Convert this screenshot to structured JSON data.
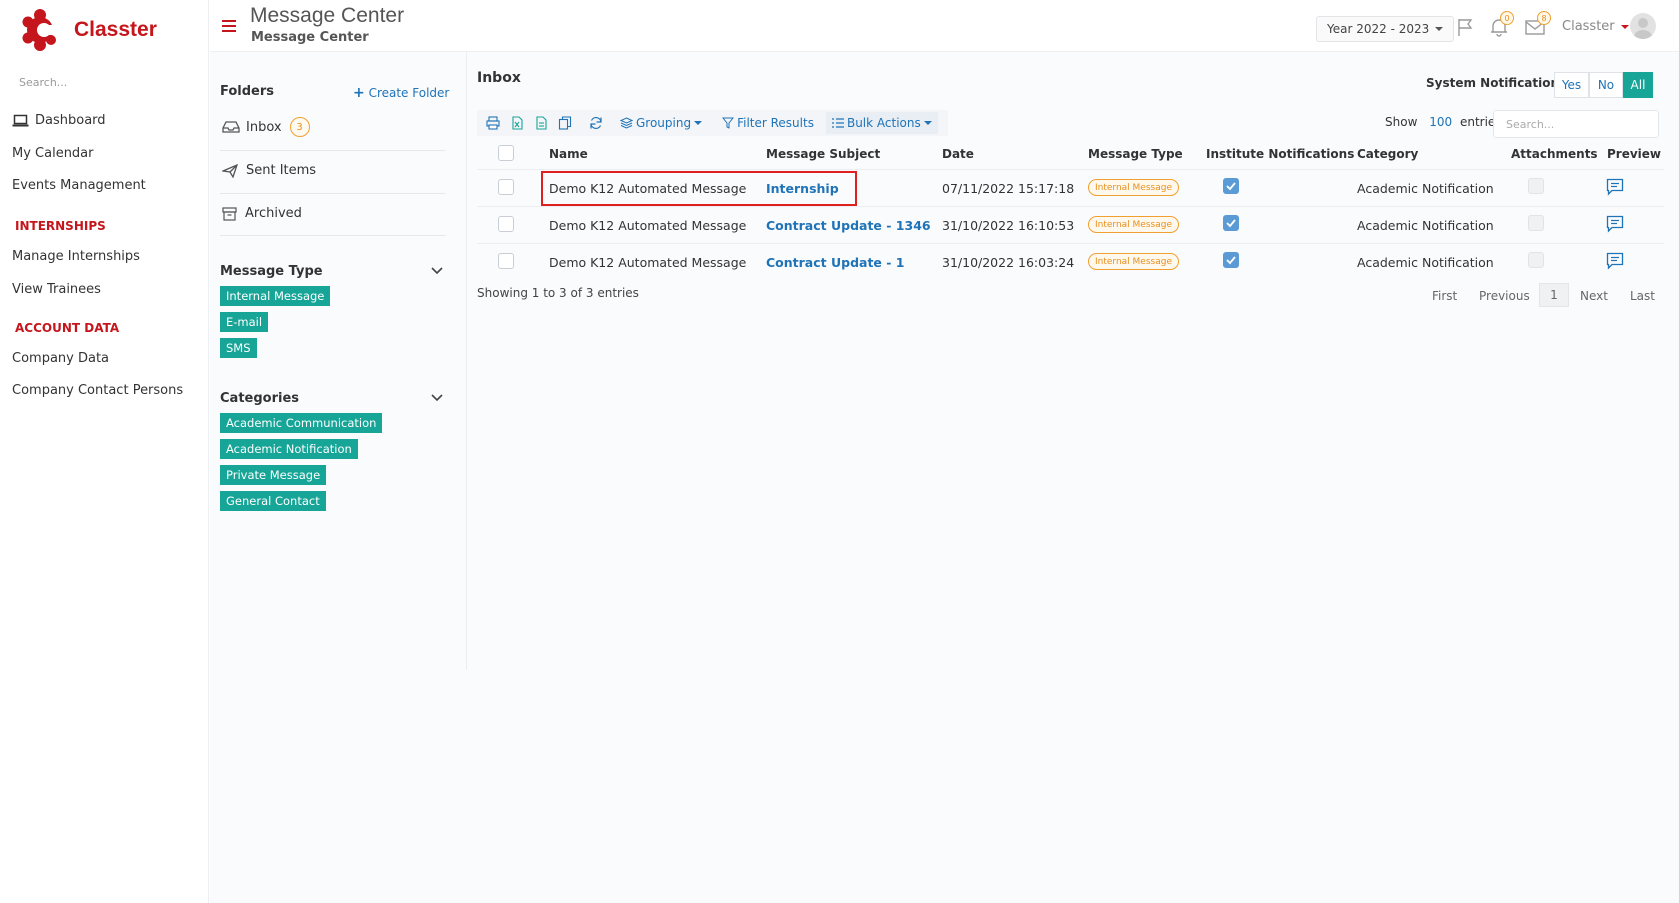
{
  "brand": {
    "name": "Classter"
  },
  "sidebar": {
    "search_placeholder": "Search...",
    "items": [
      {
        "label": "Dashboard"
      },
      {
        "label": "My Calendar"
      },
      {
        "label": "Events Management"
      }
    ],
    "sections": [
      {
        "heading": "INTERNSHIPS",
        "items": [
          {
            "label": "Manage Internships"
          },
          {
            "label": "View Trainees"
          }
        ]
      },
      {
        "heading": "ACCOUNT DATA",
        "items": [
          {
            "label": "Company Data"
          },
          {
            "label": "Company Contact Persons"
          }
        ]
      }
    ]
  },
  "header": {
    "title": "Message Center",
    "subtitle": "Message Center",
    "year_select": "Year 2022 - 2023",
    "notifications_count": "0",
    "messages_count": "8",
    "user_name": "Classter"
  },
  "folders": {
    "title": "Folders",
    "create_label": "Create Folder",
    "items": [
      {
        "label": "Inbox",
        "count": "3"
      },
      {
        "label": "Sent Items"
      },
      {
        "label": "Archived"
      }
    ]
  },
  "message_types": {
    "title": "Message Type",
    "tags": [
      "Internal Message",
      "E-mail",
      "SMS"
    ]
  },
  "categories": {
    "title": "Categories",
    "tags": [
      "Academic Communication",
      "Academic Notification",
      "Private Message",
      "General Contact"
    ]
  },
  "inbox": {
    "title": "Inbox",
    "system_notifications_label": "System Notifications:",
    "system_notifications_options": [
      "Yes",
      "No",
      "All"
    ],
    "system_notifications_selected": "All",
    "toolbar": {
      "grouping": "Grouping",
      "filter": "Filter Results",
      "bulk": "Bulk Actions"
    },
    "show_label": "Show",
    "show_count": "100",
    "entries_label": "entries",
    "search_placeholder": "Search...",
    "columns": [
      "Name",
      "Message Subject",
      "Date",
      "Message Type",
      "Institute Notifications",
      "Category",
      "Attachments",
      "Preview"
    ],
    "rows": [
      {
        "name": "Demo K12 Automated Message",
        "subject": "Internship",
        "date": "07/11/2022 15:17:18",
        "type": "Internal Message",
        "institute": true,
        "category": "Academic Notification",
        "attachments": false
      },
      {
        "name": "Demo K12 Automated Message",
        "subject": "Contract Update - 1346",
        "date": "31/10/2022 16:10:53",
        "type": "Internal Message",
        "institute": true,
        "category": "Academic Notification",
        "attachments": false
      },
      {
        "name": "Demo K12 Automated Message",
        "subject": "Contract Update - 1",
        "date": "31/10/2022 16:03:24",
        "type": "Internal Message",
        "institute": true,
        "category": "Academic Notification",
        "attachments": false
      }
    ],
    "showing_text": "Showing 1 to 3 of 3 entries",
    "pagination": {
      "first": "First",
      "previous": "Previous",
      "current": "1",
      "next": "Next",
      "last": "Last"
    }
  },
  "colors": {
    "brand_red": "#c4161c",
    "accent_teal": "#16a597",
    "link_blue": "#1f73b7",
    "badge_orange": "#f0a030",
    "highlight_red": "#e02020"
  }
}
